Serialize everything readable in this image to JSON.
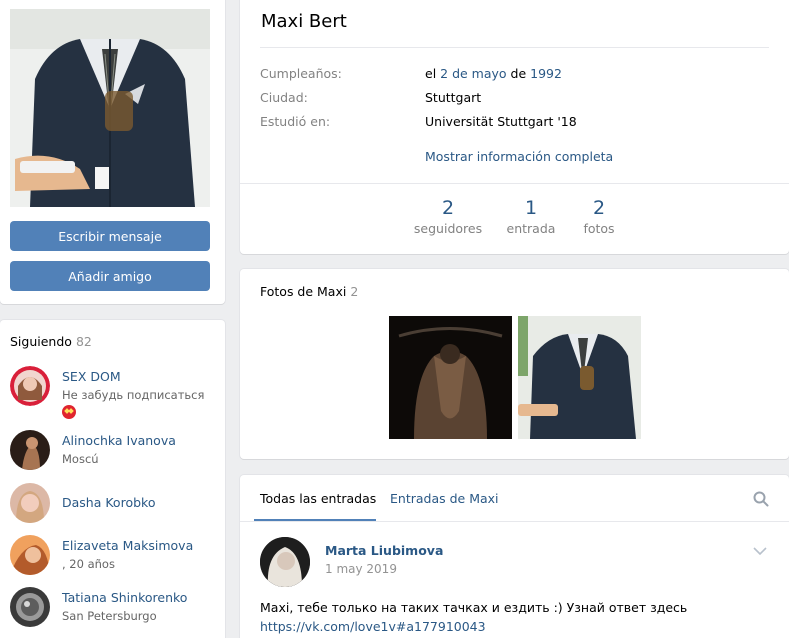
{
  "profile": {
    "name": "Maxi Bert",
    "birthday_label": "Cumpleaños:",
    "birthday_prefix": "el",
    "birthday_daymonth": "2 de mayo",
    "birthday_de": "de",
    "birthday_year": "1992",
    "city_label": "Ciudad:",
    "city": "Stuttgart",
    "studied_label": "Estudió en:",
    "studied": "Universität Stuttgart '18",
    "show_full": "Mostrar información completa",
    "counters": [
      {
        "num": "2",
        "label": "seguidores"
      },
      {
        "num": "1",
        "label": "entrada"
      },
      {
        "num": "2",
        "label": "fotos"
      }
    ]
  },
  "actions": {
    "message": "Escribir mensaje",
    "add_friend": "Añadir amigo"
  },
  "following": {
    "title": "Siguiendo",
    "count": "82",
    "items": [
      {
        "name": "SEX DOM",
        "sub": "Не забудь подписаться",
        "has_emoji": true
      },
      {
        "name": "Alinochka Ivanova",
        "sub": "Moscú"
      },
      {
        "name": "Dasha Korobko",
        "sub": ""
      },
      {
        "name": "Elizaveta Maksimova",
        "sub": ", 20 años"
      },
      {
        "name": "Tatiana Shinkorenko",
        "sub": "San Petersburgo"
      }
    ]
  },
  "photos": {
    "title": "Fotos de Maxi",
    "count": "2"
  },
  "wall": {
    "tabs": [
      "Todas las entradas",
      "Entradas de Maxi"
    ],
    "post": {
      "author": "Marta Liubimova",
      "date": "1 may 2019",
      "text": "Maxi, тебе только на таких тачках и ездить :) Узнай ответ здесь",
      "link": "https://vk.com/love1v#a177910043"
    }
  },
  "colors": {
    "accent": "#5181b8",
    "link": "#2a5885",
    "background": "#edeef0"
  }
}
